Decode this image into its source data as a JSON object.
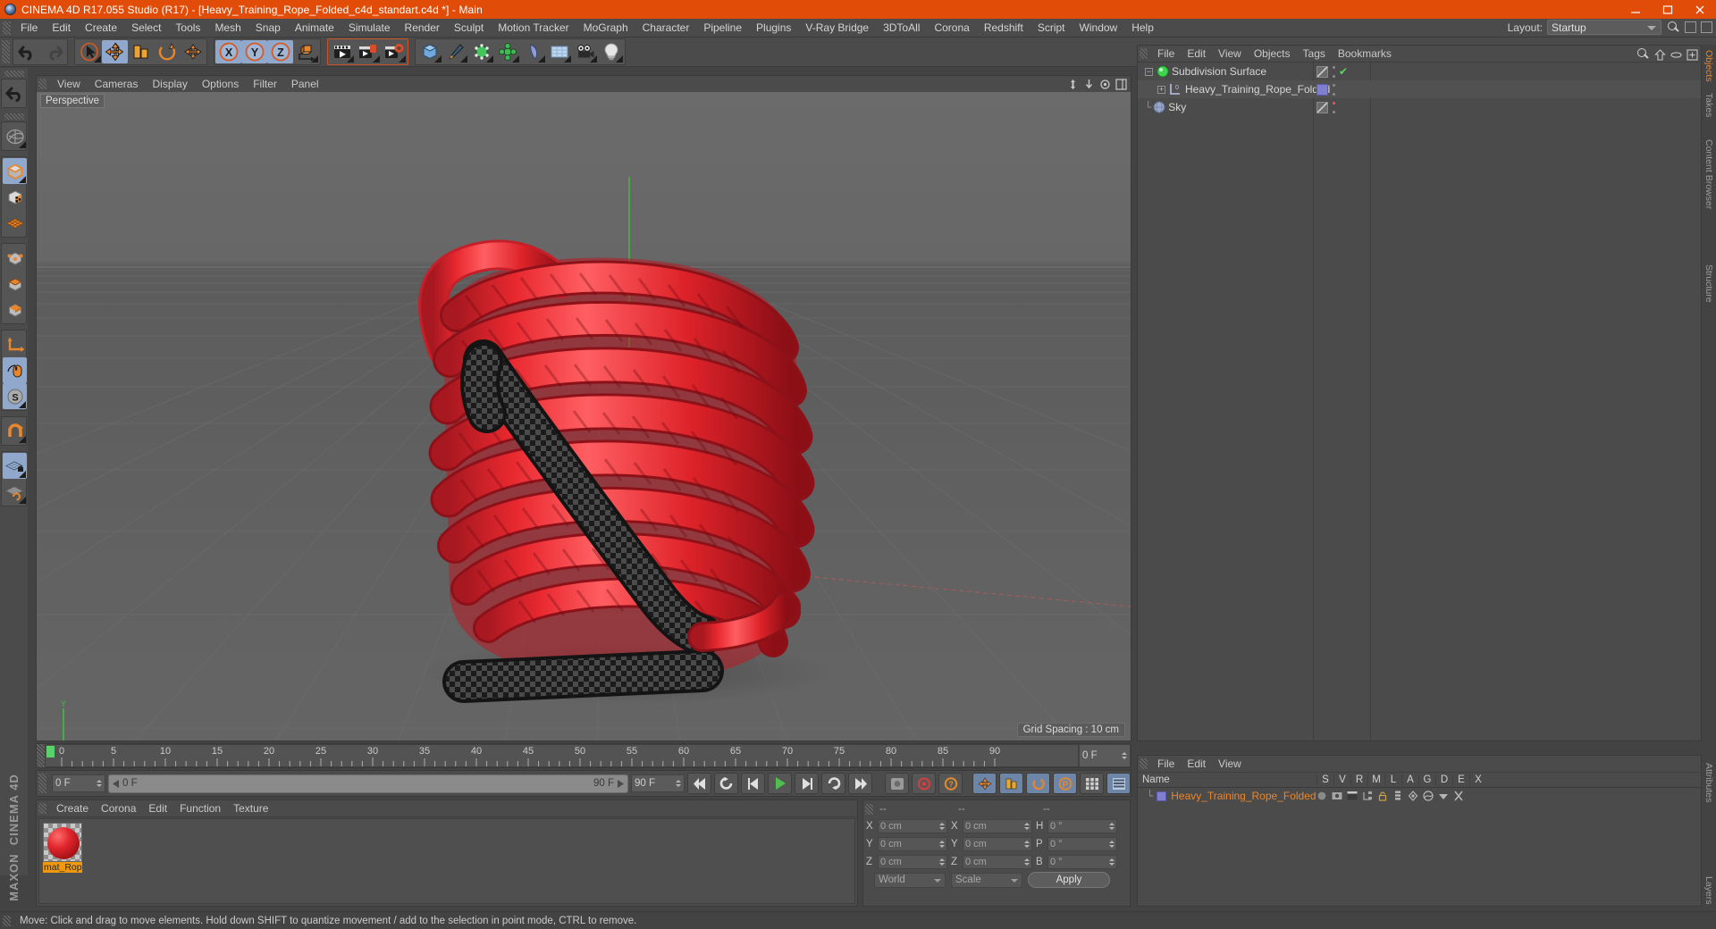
{
  "window": {
    "title": "CINEMA 4D R17.055 Studio (R17) - [Heavy_Training_Rope_Folded_c4d_standart.c4d *] - Main",
    "minimize": "minimize-button",
    "maximize": "maximize-button",
    "close": "close-button"
  },
  "menubar": {
    "items": [
      "File",
      "Edit",
      "Create",
      "Select",
      "Tools",
      "Mesh",
      "Snap",
      "Animate",
      "Simulate",
      "Render",
      "Sculpt",
      "Motion Tracker",
      "MoGraph",
      "Character",
      "Pipeline",
      "Plugins",
      "V-Ray Bridge",
      "3DToAll",
      "Corona",
      "Redshift",
      "Script",
      "Window",
      "Help"
    ],
    "layout_label": "Layout:",
    "layout_value": "Startup"
  },
  "viewport": {
    "menu": [
      "View",
      "Cameras",
      "Display",
      "Options",
      "Filter",
      "Panel"
    ],
    "view_name": "Perspective",
    "grid_spacing": "Grid Spacing : 10 cm",
    "axis_x": "X",
    "axis_y": "Y",
    "axis_z": "Z"
  },
  "object_manager": {
    "menu": [
      "File",
      "Edit",
      "View",
      "Objects",
      "Tags",
      "Bookmarks"
    ],
    "items": [
      {
        "name": "Subdivision Surface",
        "indent": 0,
        "icon": "subdivision-surface-icon",
        "swatch": "diagonal",
        "mark": "check"
      },
      {
        "name": "Heavy_Training_Rope_Folded",
        "indent": 1,
        "icon": "null-object-icon",
        "swatch": "blue",
        "mark": "dots"
      },
      {
        "name": "Sky",
        "indent": 0,
        "icon": "sky-object-icon",
        "swatch": "diagonal",
        "mark": "reddot"
      }
    ],
    "vtabs": [
      "Objects",
      "Takes"
    ]
  },
  "attribute_manager": {
    "menu": [
      "File",
      "Edit",
      "View"
    ],
    "columns": [
      "Name",
      "S",
      "V",
      "R",
      "M",
      "L",
      "A",
      "G",
      "D",
      "E",
      "X"
    ],
    "rows": [
      {
        "name": "Heavy_Training_Rope_Folded"
      }
    ],
    "vtab": "Attributes"
  },
  "timeline": {
    "ticks": [
      "0",
      "5",
      "10",
      "15",
      "20",
      "25",
      "30",
      "35",
      "40",
      "45",
      "50",
      "55",
      "60",
      "65",
      "70",
      "75",
      "80",
      "85",
      "90"
    ],
    "current_frame": "0 F"
  },
  "playback": {
    "start_field": "0 F",
    "range_start": "0 F",
    "range_end": "90 F",
    "end_field": "90 F",
    "buttons": [
      "go-to-start",
      "rewind",
      "step-back",
      "play",
      "step-forward",
      "loop",
      "go-to-end"
    ]
  },
  "material_manager": {
    "menu": [
      "Create",
      "Corona",
      "Edit",
      "Function",
      "Texture"
    ],
    "materials": [
      {
        "name": "mat_Rope",
        "color": "#e0262c"
      }
    ]
  },
  "coordinate_manager": {
    "headers": [
      "--",
      "--",
      "--"
    ],
    "rows": [
      {
        "pos_label": "X",
        "pos_value": "0 cm",
        "size_label": "X",
        "size_value": "0 cm",
        "rot_label": "H",
        "rot_value": "0 °"
      },
      {
        "pos_label": "Y",
        "pos_value": "0 cm",
        "size_label": "Y",
        "size_value": "0 cm",
        "rot_label": "P",
        "rot_value": "0 °"
      },
      {
        "pos_label": "Z",
        "pos_value": "0 cm",
        "size_label": "Z",
        "size_value": "0 cm",
        "rot_label": "B",
        "rot_value": "0 °"
      }
    ],
    "coord_system": "World",
    "transform_mode": "Scale",
    "apply_label": "Apply"
  },
  "statusbar": {
    "message": "Move: Click and drag to move elements. Hold down SHIFT to quantize movement / add to the selection in point mode, CTRL to remove."
  },
  "brand": {
    "name_top": "MAXON",
    "name_bottom": "CINEMA 4D"
  },
  "colors": {
    "title_bar": "#e14d09",
    "panel_bg": "#4b4b4b",
    "viewport_bg": "#636363",
    "accent_orange": "#e8862d",
    "rope_red": "#e0262c",
    "selected_blue": "#8fa8cc"
  },
  "toolbar": {
    "groups": [
      {
        "name": "history",
        "buttons": [
          {
            "name": "undo-button",
            "active": false
          },
          {
            "name": "redo-button",
            "active": false
          }
        ]
      },
      {
        "name": "transform",
        "buttons": [
          {
            "name": "select-tool-button",
            "active": false
          },
          {
            "name": "move-tool-button",
            "active": true
          },
          {
            "name": "scale-tool-button",
            "active": false
          },
          {
            "name": "rotate-tool-button",
            "active": false
          },
          {
            "name": "add-tool-button",
            "active": false
          }
        ]
      },
      {
        "name": "axis-lock",
        "buttons": [
          {
            "name": "lock-x-axis-button",
            "active": true
          },
          {
            "name": "lock-y-axis-button",
            "active": true
          },
          {
            "name": "lock-z-axis-button",
            "active": true
          },
          {
            "name": "world-coordinate-button",
            "active": false
          }
        ]
      },
      {
        "name": "render",
        "buttons": [
          {
            "name": "render-view-button",
            "active": false
          },
          {
            "name": "render-to-picture-viewer-button",
            "active": false
          },
          {
            "name": "render-settings-button",
            "active": false
          }
        ]
      },
      {
        "name": "create",
        "buttons": [
          {
            "name": "add-cube-button",
            "active": false
          },
          {
            "name": "add-spline-button",
            "active": false
          },
          {
            "name": "add-generator-button",
            "active": false
          },
          {
            "name": "add-array-button",
            "active": false
          },
          {
            "name": "add-deformer-button",
            "active": false
          },
          {
            "name": "add-floor-button",
            "active": false
          },
          {
            "name": "add-camera-button",
            "active": false
          },
          {
            "name": "add-light-button",
            "active": false
          }
        ]
      }
    ]
  },
  "left_toolbar": {
    "buttons": [
      {
        "name": "undo-view-button",
        "active": false
      },
      {
        "name": "live-selection-button",
        "active": false
      },
      {
        "name": "model-mode-button",
        "active": true
      },
      {
        "name": "texture-mode-button",
        "active": false
      },
      {
        "name": "polygon-mode-button",
        "active": false
      },
      {
        "name": "points-mode-button",
        "active": false
      },
      {
        "name": "edges-mode-button",
        "active": false
      },
      {
        "name": "polygons-mode-button",
        "active": false
      },
      {
        "name": "axis-mode-button",
        "active": false
      },
      {
        "name": "viewport-solo-button",
        "active": true
      },
      {
        "name": "enable-snap-button",
        "active": true
      },
      {
        "name": "magnet-tool-button",
        "active": false
      },
      {
        "name": "workplane-lock-button",
        "active": true
      },
      {
        "name": "workplane-toggle-button",
        "active": false
      }
    ]
  }
}
